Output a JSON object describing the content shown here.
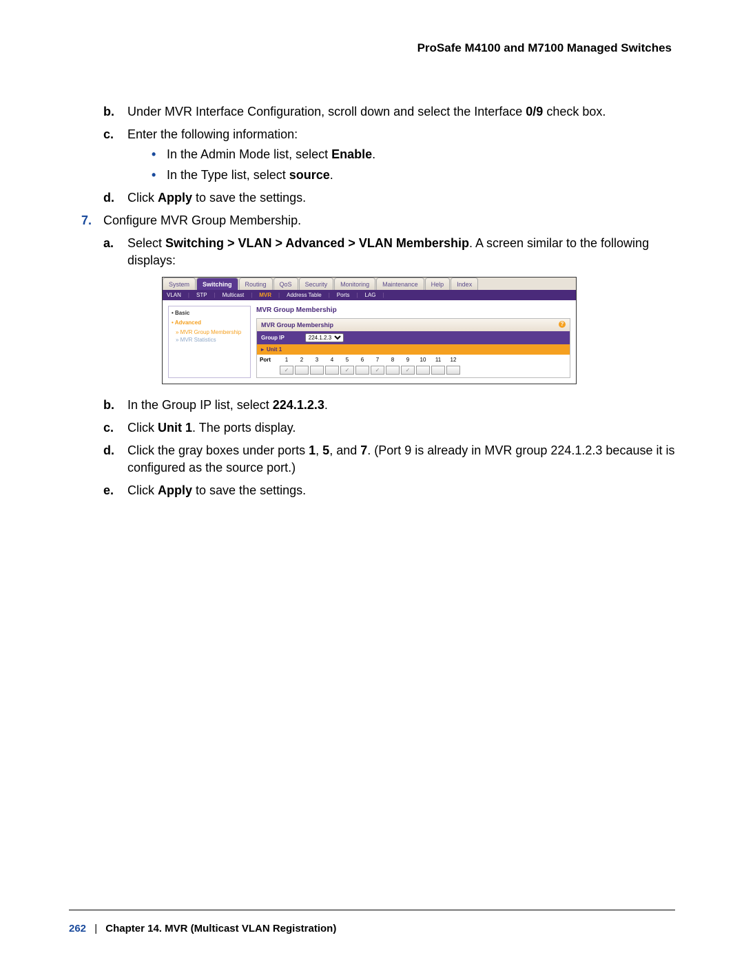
{
  "header": "ProSafe M4100 and M7100 Managed Switches",
  "step_b": {
    "pre": "Under MVR Interface Configuration, scroll down and select the Interface ",
    "bold": "0/9",
    "post": " check box."
  },
  "step_c": "Enter the following information:",
  "bullet_c1": {
    "pre": "In the Admin Mode list, select ",
    "bold": "Enable",
    "post": "."
  },
  "bullet_c2": {
    "pre": "In the Type list, select ",
    "bold": "source",
    "post": "."
  },
  "step_d": {
    "pre": "Click ",
    "bold": "Apply",
    "post": " to save the settings."
  },
  "step7": "Configure MVR Group Membership.",
  "step7a": {
    "pre": "Select ",
    "bold": "Switching > VLAN > Advanced > VLAN Membership",
    "post": ". A screen similar to the following displays:"
  },
  "step7b": {
    "pre": "In the Group IP list, select ",
    "bold": "224.1.2.3",
    "post": "."
  },
  "step7c": {
    "pre": "Click ",
    "bold": "Unit 1",
    "post": ". The ports display."
  },
  "step7d": {
    "pre": "Click the gray boxes under ports ",
    "b1": "1",
    "mid1": ", ",
    "b2": "5",
    "mid2": ", and ",
    "b3": "7",
    "post": ". (Port 9 is already in MVR group 224.1.2.3 because it is configured as the source port.)"
  },
  "step7e": {
    "pre": "Click ",
    "bold": "Apply",
    "post": " to save the settings."
  },
  "ui": {
    "tabs": [
      "System",
      "Switching",
      "Routing",
      "QoS",
      "Security",
      "Monitoring",
      "Maintenance",
      "Help",
      "Index"
    ],
    "active_tab": "Switching",
    "subtabs": [
      "VLAN",
      "STP",
      "Multicast",
      "MVR",
      "Address Table",
      "Ports",
      "LAG"
    ],
    "active_subtab": "MVR",
    "sidebar": {
      "basic": "Basic",
      "advanced": "Advanced",
      "mvr_group": "MVR Group Membership",
      "mvr_stats": "MVR Statistics"
    },
    "main_title": "MVR Group Membership",
    "panel_head": "MVR Group Membership",
    "group_ip_label": "Group IP",
    "group_ip_value": "224.1.2.3",
    "unit_label": "Unit 1",
    "port_label": "Port",
    "ports": [
      "1",
      "2",
      "3",
      "4",
      "5",
      "6",
      "7",
      "8",
      "9",
      "10",
      "11",
      "12"
    ],
    "checked_ports": [
      1,
      5,
      7,
      9
    ]
  },
  "footer": {
    "page": "262",
    "chapter": "Chapter 14.  MVR (Multicast VLAN Registration)"
  }
}
